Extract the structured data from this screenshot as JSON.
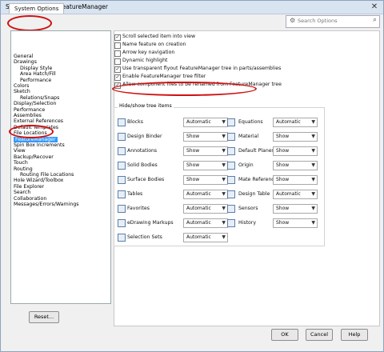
{
  "window": {
    "title": "System Options - FeatureManager"
  },
  "tab": {
    "label": "System Options"
  },
  "search": {
    "placeholder": "Search Options"
  },
  "tree": [
    {
      "label": "General",
      "indent": 0
    },
    {
      "label": "Drawings",
      "indent": 0
    },
    {
      "label": "Display Style",
      "indent": 1
    },
    {
      "label": "Area Hatch/Fill",
      "indent": 1
    },
    {
      "label": "Performance",
      "indent": 1
    },
    {
      "label": "Colors",
      "indent": 0
    },
    {
      "label": "Sketch",
      "indent": 0
    },
    {
      "label": "Relations/Snaps",
      "indent": 1
    },
    {
      "label": "Display/Selection",
      "indent": 0
    },
    {
      "label": "Performance",
      "indent": 0
    },
    {
      "label": "Assemblies",
      "indent": 0
    },
    {
      "label": "External References",
      "indent": 0
    },
    {
      "label": "Default Templates",
      "indent": 0
    },
    {
      "label": "File Locations",
      "indent": 0
    },
    {
      "label": "FeatureManager",
      "indent": 0,
      "selected": true
    },
    {
      "label": "Spin Box Increments",
      "indent": 0
    },
    {
      "label": "View",
      "indent": 0
    },
    {
      "label": "Backup/Recover",
      "indent": 0
    },
    {
      "label": "Touch",
      "indent": 0
    },
    {
      "label": "Routing",
      "indent": 0
    },
    {
      "label": "Routing File Locations",
      "indent": 1
    },
    {
      "label": "Hole Wizard/Toolbox",
      "indent": 0
    },
    {
      "label": "File Explorer",
      "indent": 0
    },
    {
      "label": "Search",
      "indent": 0
    },
    {
      "label": "Collaboration",
      "indent": 0
    },
    {
      "label": "Messages/Errors/Warnings",
      "indent": 0
    }
  ],
  "options": [
    {
      "label": "Scroll selected item into view",
      "checked": true
    },
    {
      "label": "Name feature on creation",
      "checked": false
    },
    {
      "label": "Arrow key navigation",
      "checked": false
    },
    {
      "label": "Dynamic highlight",
      "checked": false
    },
    {
      "label": "Use transparent flyout FeatureManager tree in parts/assemblies",
      "checked": true
    },
    {
      "label": "Enable FeatureManager tree filter",
      "checked": true
    },
    {
      "label": "Allow component files to be renamed from FeatureManager tree",
      "checked": true
    }
  ],
  "hide_show": {
    "title": "Hide/show tree items",
    "left": [
      {
        "label": "Blocks",
        "value": "Automatic",
        "icon": "blocks-icon"
      },
      {
        "label": "Design Binder",
        "value": "Show",
        "icon": "design-binder-icon"
      },
      {
        "label": "Annotations",
        "value": "Show",
        "icon": "annotations-icon"
      },
      {
        "label": "Solid Bodies",
        "value": "Show",
        "icon": "solid-bodies-icon"
      },
      {
        "label": "Surface Bodies",
        "value": "Show",
        "icon": "surface-bodies-icon"
      },
      {
        "label": "Tables",
        "value": "Automatic",
        "icon": "tables-icon"
      },
      {
        "label": "Favorites",
        "value": "Automatic",
        "icon": "favorites-icon"
      },
      {
        "label": "eDrawing Markups",
        "value": "Automatic",
        "icon": "edrawing-markups-icon"
      },
      {
        "label": "Selection Sets",
        "value": "Automatic",
        "icon": "selection-sets-icon"
      }
    ],
    "right": [
      {
        "label": "Equations",
        "value": "Automatic",
        "icon": "equations-icon"
      },
      {
        "label": "Material",
        "value": "Show",
        "icon": "material-icon"
      },
      {
        "label": "Default Planes",
        "value": "Show",
        "icon": "default-planes-icon"
      },
      {
        "label": "Origin",
        "value": "Show",
        "icon": "origin-icon"
      },
      {
        "label": "Mate References",
        "value": "Show",
        "icon": "mate-references-icon"
      },
      {
        "label": "Design Table",
        "value": "Automatic",
        "icon": "design-table-icon"
      },
      {
        "label": "Sensors",
        "value": "Show",
        "icon": "sensors-icon"
      },
      {
        "label": "History",
        "value": "Show",
        "icon": "history-icon"
      }
    ]
  },
  "buttons": {
    "reset": "Reset...",
    "ok": "OK",
    "cancel": "Cancel",
    "help": "Help"
  },
  "accent": "#d01010"
}
